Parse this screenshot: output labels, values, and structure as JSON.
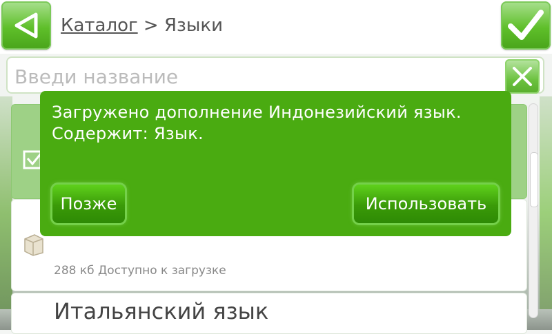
{
  "header": {
    "breadcrumb_root": "Каталог",
    "breadcrumb_separator": ">",
    "breadcrumb_current": "Языки"
  },
  "search": {
    "placeholder": "Введи название",
    "value": ""
  },
  "list": {
    "items": [
      {
        "status": "selected",
        "icon": "checkbox-icon"
      },
      {
        "icon": "package-icon",
        "meta": "288 кб Доступно к загрузке"
      },
      {
        "title": "Итальянский язык"
      }
    ]
  },
  "dialog": {
    "line1": "Загружено дополнение Индонезийский язык.",
    "line2": "Содержит: Язык.",
    "later_label": "Позже",
    "use_label": "Использовать"
  },
  "colors": {
    "accent_green": "#4aab11",
    "selected_row": "#9ed186",
    "button_green": "#5fbf2a"
  }
}
